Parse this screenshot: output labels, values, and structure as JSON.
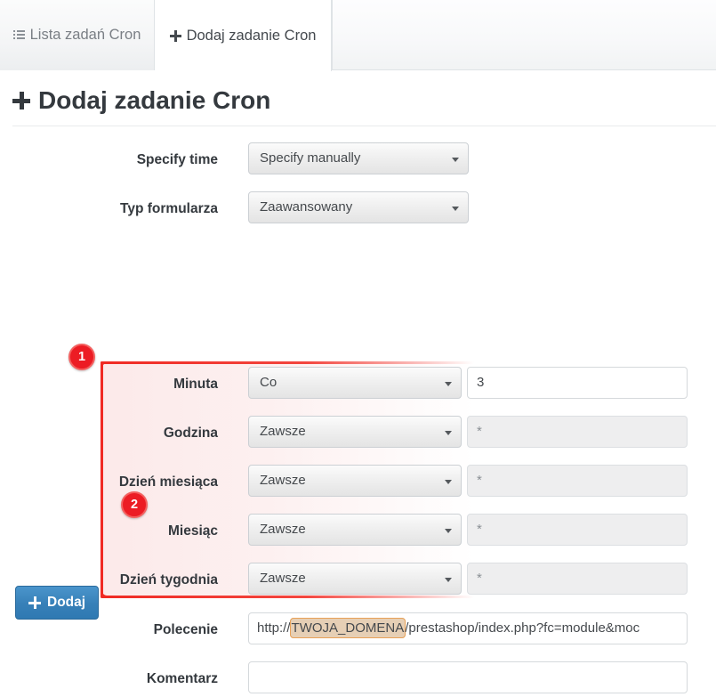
{
  "tabs": [
    {
      "label": "Lista zadań Cron",
      "icon": "list-icon",
      "active": false
    },
    {
      "label": "Dodaj zadanie Cron",
      "icon": "plus-icon",
      "active": true
    }
  ],
  "page_title": "Dodaj zadanie Cron",
  "form": {
    "specify_time": {
      "label": "Specify time",
      "value": "Specify manually"
    },
    "form_type": {
      "label": "Typ formularza",
      "value": "Zaawansowany"
    },
    "cron_rows": [
      {
        "label": "Minuta",
        "select": "Co",
        "value": "3",
        "disabled": false
      },
      {
        "label": "Godzina",
        "select": "Zawsze",
        "value": "*",
        "disabled": true
      },
      {
        "label": "Dzień miesiąca",
        "select": "Zawsze",
        "value": "*",
        "disabled": true
      },
      {
        "label": "Miesiąc",
        "select": "Zawsze",
        "value": "*",
        "disabled": true
      },
      {
        "label": "Dzień tygodnia",
        "select": "Zawsze",
        "value": "*",
        "disabled": true
      }
    ],
    "command": {
      "label": "Polecenie",
      "prefix": "http://",
      "highlight": "TWOJA_DOMENA",
      "suffix": "/prestashop/index.php?fc=module&moc"
    },
    "comment": {
      "label": "Komentarz",
      "value": ""
    },
    "submit": {
      "label": "Dodaj",
      "icon": "plus-icon"
    }
  },
  "annotations": [
    {
      "number": "1",
      "target": "cron-fields-group"
    },
    {
      "number": "2",
      "target": "command-field"
    }
  ],
  "colors": {
    "accent_red": "#ec1c24",
    "highlight_orange": "#e8a158",
    "button_blue": "#3780b8"
  }
}
